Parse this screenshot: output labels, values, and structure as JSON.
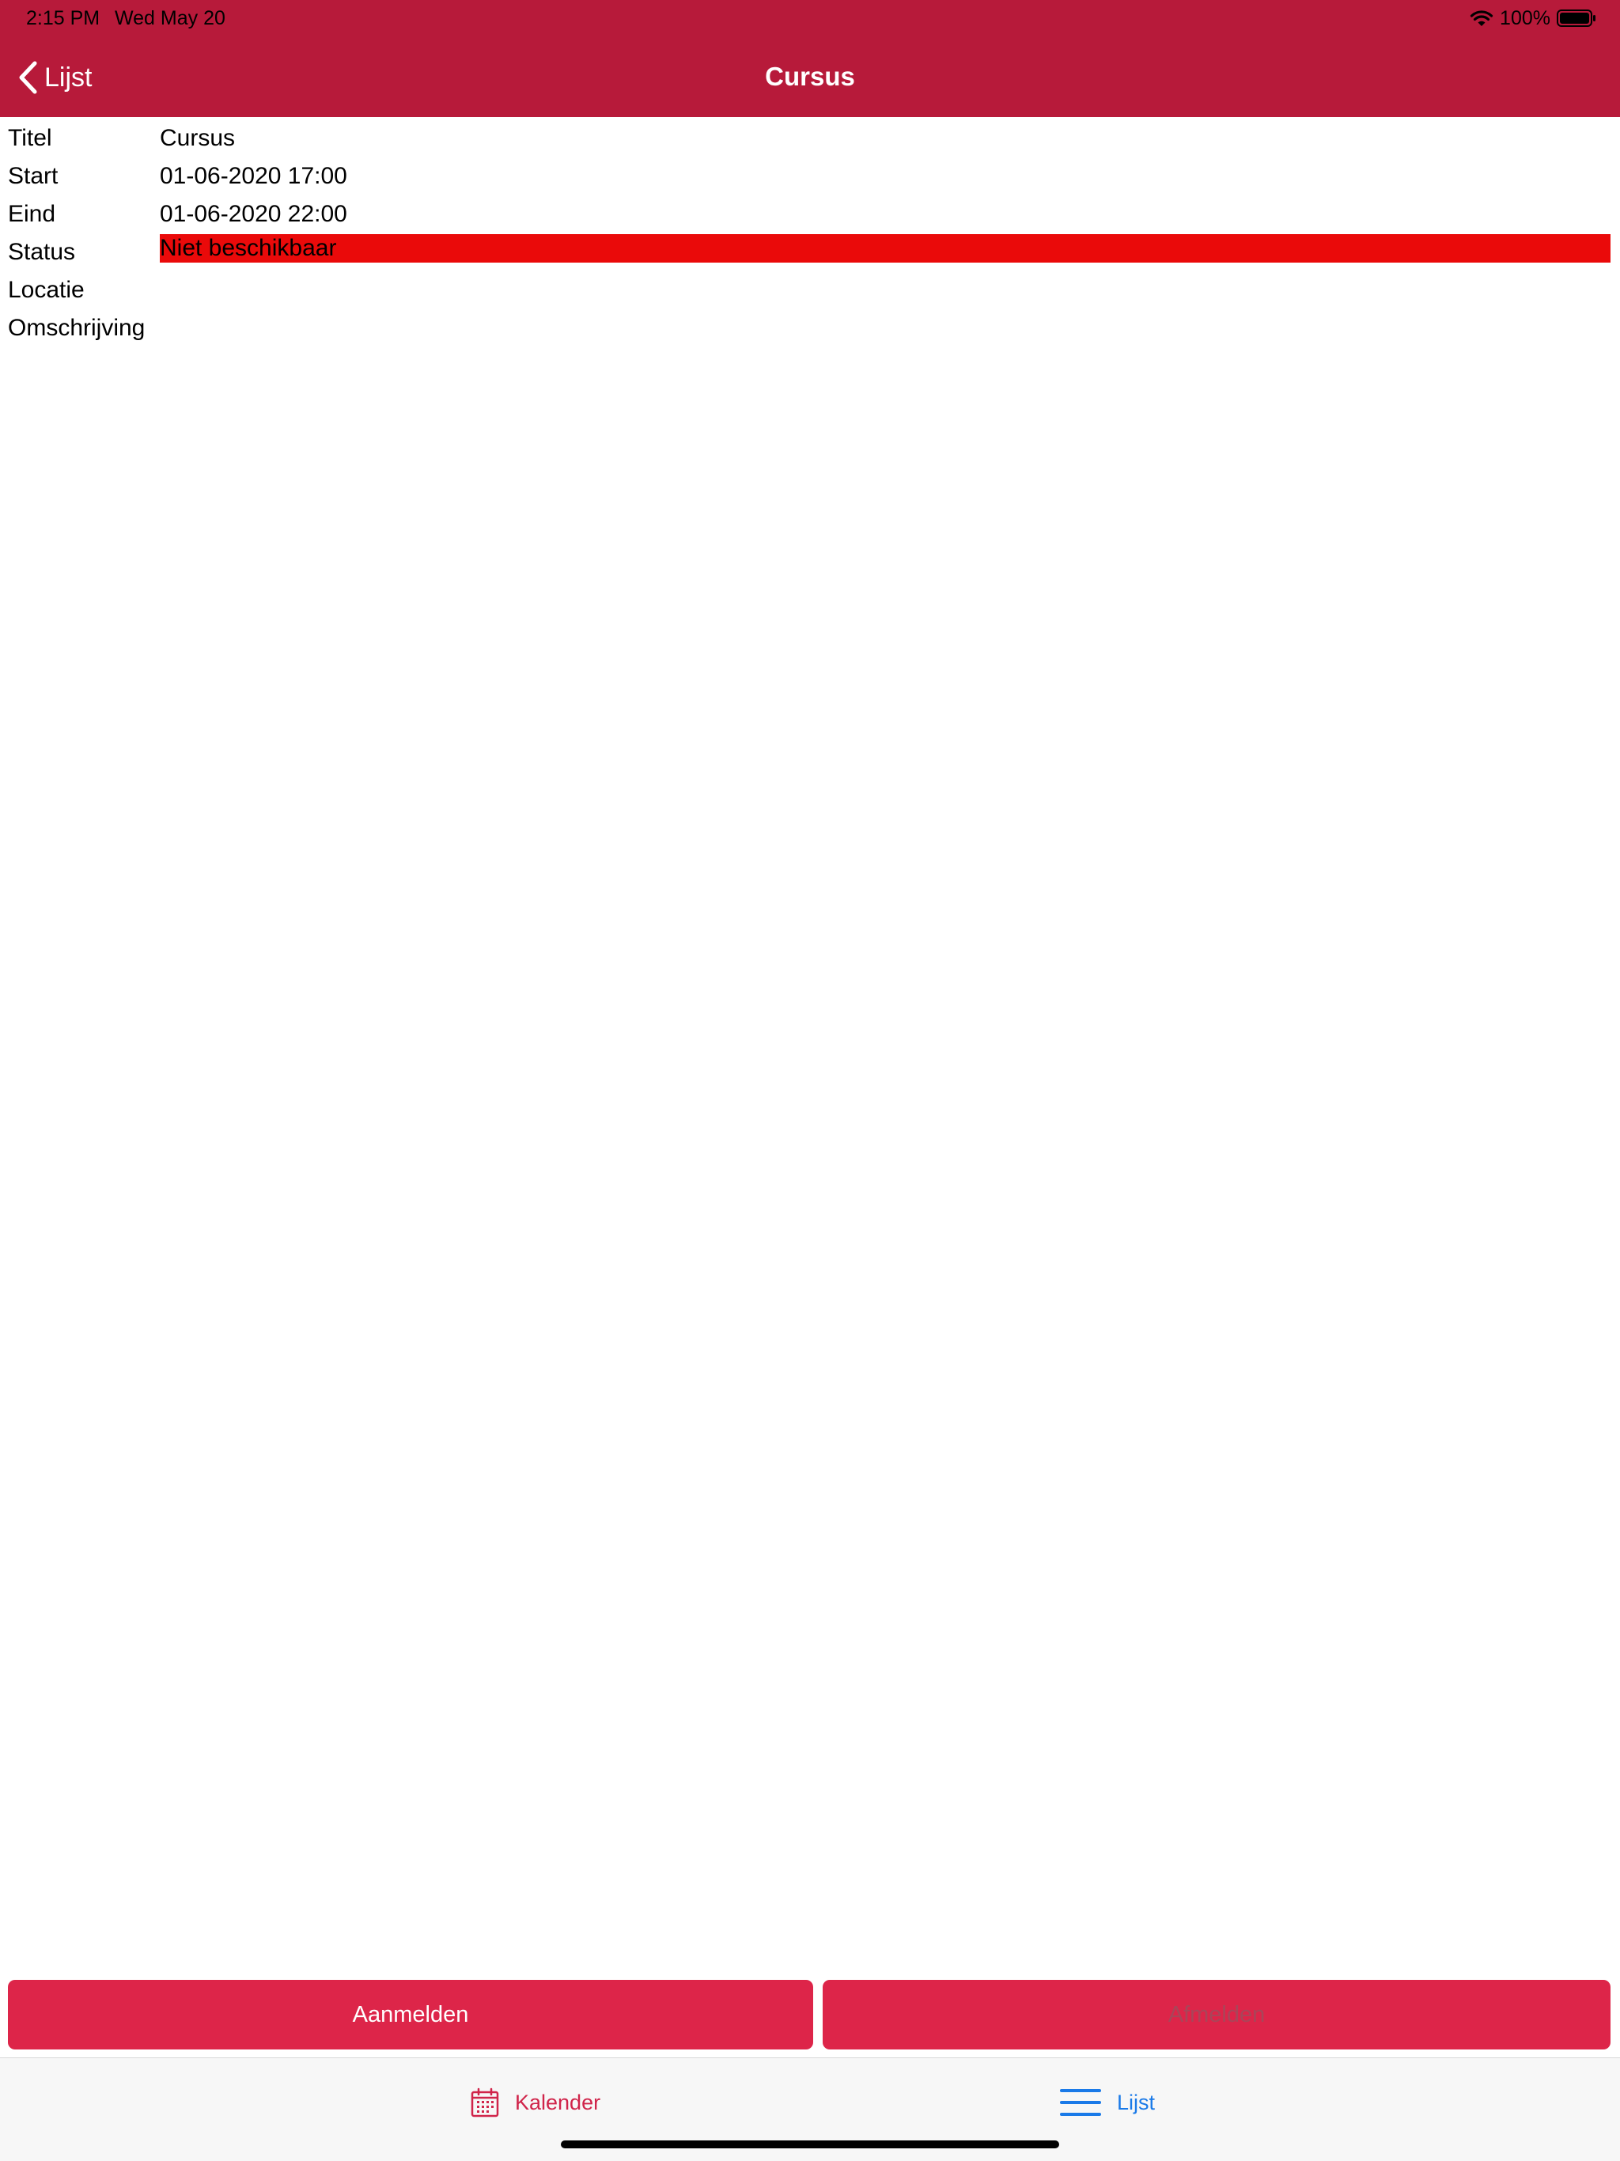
{
  "colors": {
    "header_bg": "#b71a3a",
    "status_highlight": "#ea0a0a",
    "button_bg": "#dd2549",
    "tab_active": "#1a7ae8",
    "tab_inactive": "#d0244a"
  },
  "status_bar": {
    "time": "2:15 PM",
    "date": "Wed May 20",
    "battery": "100%",
    "icons": [
      "wifi-icon",
      "battery-icon"
    ]
  },
  "nav": {
    "back_label": "Lijst",
    "title": "Cursus",
    "back_icon": "chevron-left-icon"
  },
  "details": {
    "rows": [
      {
        "label": "Titel",
        "value": "Cursus"
      },
      {
        "label": "Start",
        "value": "01-06-2020 17:00"
      },
      {
        "label": "Eind",
        "value": "01-06-2020 22:00"
      },
      {
        "label": "Status",
        "value": "Niet beschikbaar"
      },
      {
        "label": "Locatie",
        "value": ""
      },
      {
        "label": "Omschrijving",
        "value": ""
      }
    ]
  },
  "actions": {
    "signup_label": "Aanmelden",
    "signoff_label": "Afmelden"
  },
  "tabs": [
    {
      "label": "Kalender",
      "icon": "calendar-icon",
      "active": false
    },
    {
      "label": "Lijst",
      "icon": "list-icon",
      "active": true
    }
  ]
}
